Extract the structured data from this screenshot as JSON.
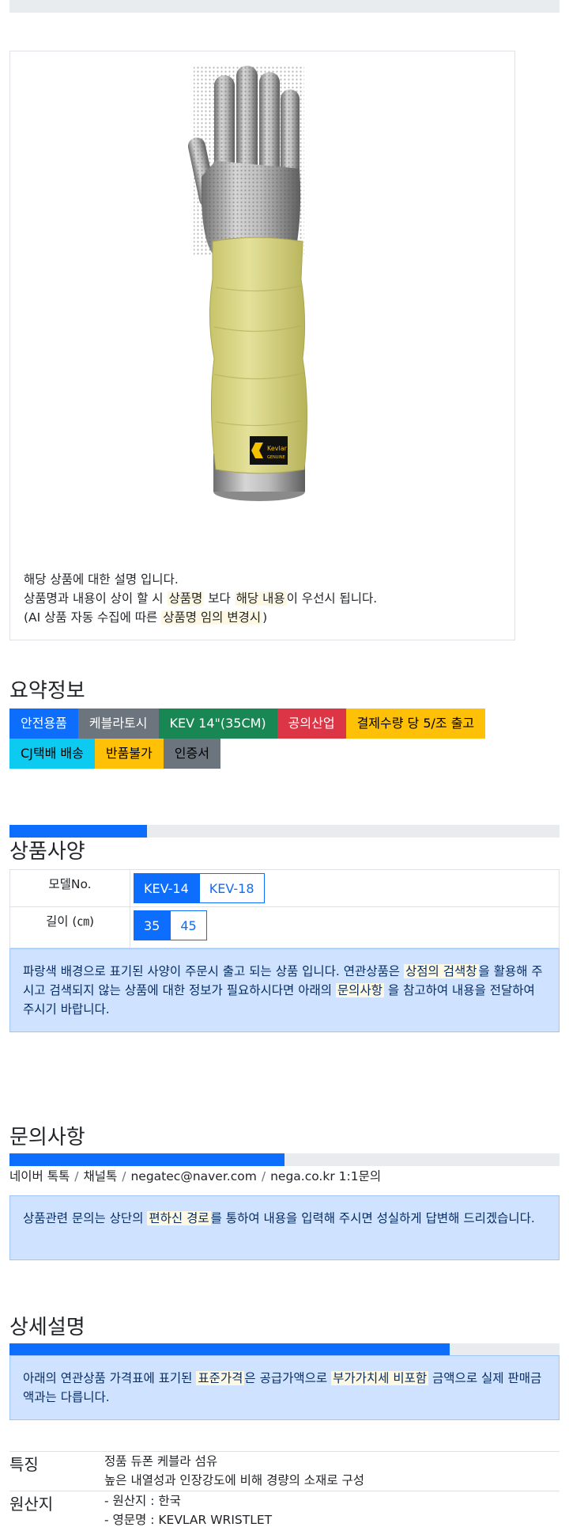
{
  "product": {
    "desc_line1": "해당 상품에 대한 설명 입니다.",
    "desc_line2_a": "상품명과 내용이 상이 할 시 ",
    "desc_line2_m1": "상품명",
    "desc_line2_b": " 보다 ",
    "desc_line2_m2": "해당 내용",
    "desc_line2_c": "이 우선시 됩니다.",
    "desc_line3_a": "(AI 상품 자동 수집에 따른 ",
    "desc_line3_m": "상품명 임의 변경시",
    "desc_line3_b": ")",
    "label_brand": "Kevlar",
    "label_sub": "GENUINE"
  },
  "summary": {
    "title": "요약정보",
    "badges": [
      {
        "label": "안전용품",
        "color": "#0d6efd",
        "text": "#ffffff"
      },
      {
        "label": "케블라토시",
        "color": "#6c757d",
        "text": "#ffffff"
      },
      {
        "label": "KEV 14\"(35CM)",
        "color": "#198754",
        "text": "#ffffff"
      },
      {
        "label": "공의산업",
        "color": "#dc3545",
        "text": "#ffffff"
      },
      {
        "label": "결제수량 당 5/조 출고",
        "color": "#ffc107",
        "text": "#000000"
      },
      {
        "label": "CJ택배 배송",
        "color": "#0dcaf0",
        "text": "#000000"
      },
      {
        "label": "반품불가",
        "color": "#ffc107",
        "text": "#000000"
      },
      {
        "label": "인증서",
        "color": "#6c757d",
        "text": "#000000"
      }
    ]
  },
  "spec": {
    "title": "상품사양",
    "progress": 0.25,
    "rows": [
      {
        "label": "모델No.",
        "options": [
          {
            "label": "KEV-14",
            "selected": true
          },
          {
            "label": "KEV-18",
            "selected": false
          }
        ]
      },
      {
        "label": "길이 (㎝)",
        "options": [
          {
            "label": "35",
            "selected": true
          },
          {
            "label": "45",
            "selected": false
          }
        ]
      }
    ],
    "note_a": "파랑색 배경으로 표기된 사양이 주문시 출고 되는 상품 입니다. 연관상품은 ",
    "note_m1": "상점의 검색창",
    "note_b": "을 활용해 주시고 검색되지 않는 상품에 대한 정보가 필요하시다면 아래의 ",
    "note_m2": "문의사항",
    "note_c": " 을 참고하여 내용을 전달하여 주시기 바랍니다."
  },
  "inquiry": {
    "title": "문의사항",
    "progress": 0.5,
    "links": [
      "네이버 톡톡",
      "채널톡",
      "negatec@naver.com",
      "nega.co.kr 1:1문의"
    ],
    "note_a": "상품관련 문의는 상단의 ",
    "note_m": "편하신 경로",
    "note_b": "를 통하여 내용을 입력해 주시면 성실하게 답변해 드리겠습니다."
  },
  "detail": {
    "title": "상세설명",
    "progress": 0.8,
    "note_a": "아래의 연관상품 가격표에 표기된 ",
    "note_m1": "표준가격",
    "note_b": "은 공급가액으로 ",
    "note_m2": "부가가치세 비포함",
    "note_c": " 금액으로 실제 판매금액과는 다릅니다.",
    "features": [
      {
        "key": "특징",
        "lines": [
          "정품 듀폰 케블라 섬유",
          "높은 내열성과 인장강도에 비해 경량의 소재로 구성"
        ]
      },
      {
        "key": "원산지",
        "lines": [
          "- 원산지 : 한국",
          "- 영문명 : KEVLAR WRISTLET"
        ]
      }
    ]
  }
}
